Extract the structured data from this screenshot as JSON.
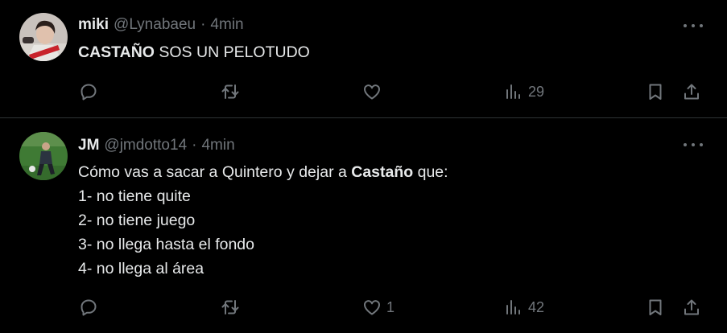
{
  "posts": [
    {
      "name": "miki",
      "handle": "@Lynabaeu",
      "separator": "·",
      "time": "4min",
      "text_bold": "CASTAÑO",
      "text_rest": " SOS UN PELOTUDO",
      "likes": "",
      "views": "29"
    },
    {
      "name": "JM",
      "handle": "@jmdotto14",
      "separator": "·",
      "time": "4min",
      "line1_pre": "Cómo vas a sacar a Quintero y dejar a ",
      "line1_bold": "Castaño",
      "line1_post": " que:",
      "lines": [
        "1- no tiene quite",
        "2- no tiene juego",
        "3- no llega hasta el fondo",
        "4- no llega al área"
      ],
      "likes": "1",
      "views": "42"
    }
  ],
  "icons": {
    "reply": "reply-icon",
    "retweet": "retweet-icon",
    "like": "heart-icon",
    "views": "views-icon",
    "bookmark": "bookmark-icon",
    "share": "share-icon",
    "more": "more-icon"
  },
  "colors": {
    "background": "#000000",
    "text": "#e7e9ea",
    "muted": "#71767b",
    "divider": "#2f3336"
  }
}
